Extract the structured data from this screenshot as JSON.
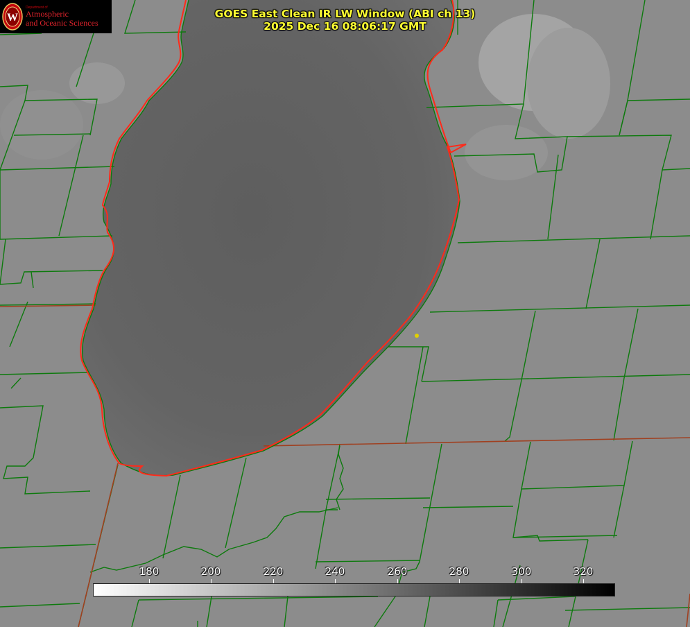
{
  "logo": {
    "department": "Department of",
    "line1": "Atmospheric",
    "line2": "and Oceanic Sciences",
    "seal_letter": "W"
  },
  "title": {
    "line1": "GOES East Clean IR LW Window (ABI ch 13)",
    "line2": "2025 Dec 16 08:06:17 GMT"
  },
  "colorbar": {
    "ticks": [
      "180",
      "200",
      "220",
      "240",
      "260",
      "280",
      "300",
      "320"
    ],
    "gradient_start": "#ffffff",
    "gradient_end": "#000000"
  },
  "colors": {
    "land": "#8a8a8a",
    "lake": "#606060",
    "county_lines": "#0d7a0d",
    "coastline": "#ff2a1a",
    "state_border": "#a04020",
    "marker": "#e0d000",
    "title_text": "#ffff33"
  }
}
